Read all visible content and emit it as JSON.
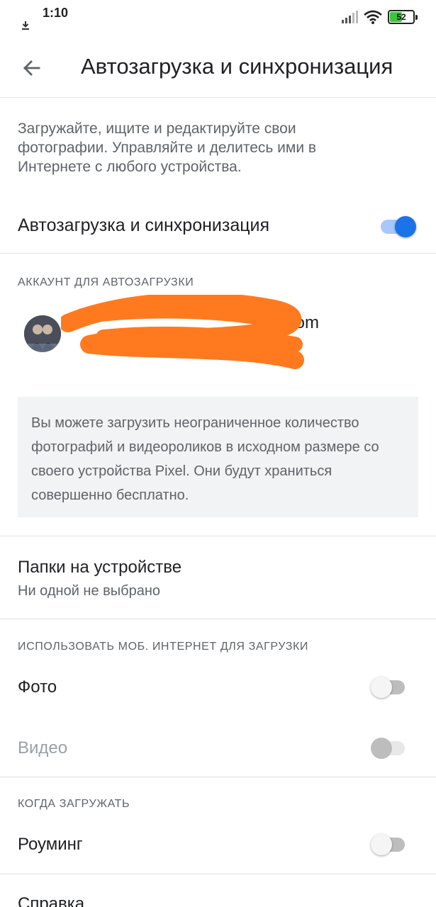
{
  "status_bar": {
    "time": "1:10",
    "battery_level": "52",
    "icons": [
      "download-icon",
      "signal-icon",
      "wifi-icon",
      "battery-icon"
    ],
    "battery_color": "#3dc43d"
  },
  "app_bar": {
    "title": "Автозагрузка и синхронизация",
    "back_icon": "arrow-back-icon"
  },
  "description": "Загружайте, ищите и редактируйте свои фотографии. Управляйте и делитесь ими в Интернете с любого устройства.",
  "main_toggle": {
    "label": "Автозагрузка и синхронизация",
    "state": "on"
  },
  "account_section": {
    "header": "Аккаунт для автозагрузки",
    "email_visible_suffix": "om"
  },
  "info_box": {
    "text": "Вы можете загрузить неограниченное количество фотографий и видеороликов в исходном размере со своего устройства Pixel. Они будут храниться совершенно бесплатно."
  },
  "device_folders": {
    "title": "Папки на устройстве",
    "subtitle": "Ни одной не выбрано"
  },
  "mobile_data_section": {
    "header": "Использовать моб. интернет для загрузки",
    "items": [
      {
        "label": "Фото",
        "state": "off",
        "enabled": true
      },
      {
        "label": "Видео",
        "state": "off",
        "enabled": false
      }
    ]
  },
  "when_section": {
    "header": "Когда загружать",
    "items": [
      {
        "label": "Роуминг",
        "state": "off",
        "enabled": true
      }
    ]
  },
  "help": {
    "label": "Справка"
  },
  "colors": {
    "accent": "#1a73e8",
    "redaction": "#ff7a1f",
    "info_bg": "#f1f3f4"
  }
}
